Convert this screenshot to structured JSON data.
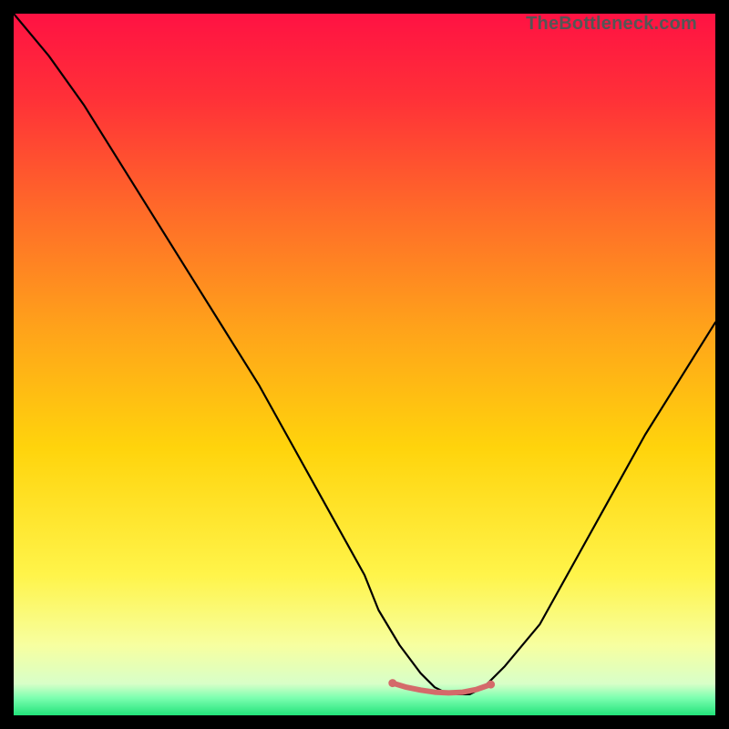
{
  "watermark": "TheBottleneck.com",
  "chart_data": {
    "type": "line",
    "title": "",
    "xlabel": "",
    "ylabel": "",
    "xlim": [
      0,
      100
    ],
    "ylim": [
      0,
      100
    ],
    "gradient_stops": [
      {
        "offset": 0.0,
        "color": "#ff1243"
      },
      {
        "offset": 0.12,
        "color": "#ff3038"
      },
      {
        "offset": 0.28,
        "color": "#ff6a29"
      },
      {
        "offset": 0.45,
        "color": "#ffa31a"
      },
      {
        "offset": 0.62,
        "color": "#ffd40c"
      },
      {
        "offset": 0.8,
        "color": "#fff44a"
      },
      {
        "offset": 0.9,
        "color": "#f7ffa0"
      },
      {
        "offset": 0.955,
        "color": "#d8ffc8"
      },
      {
        "offset": 0.975,
        "color": "#7dffb0"
      },
      {
        "offset": 1.0,
        "color": "#22e37a"
      }
    ],
    "series": [
      {
        "name": "bottleneck-curve",
        "color": "#000000",
        "width": 2.2,
        "x": [
          0,
          5,
          10,
          15,
          20,
          25,
          30,
          35,
          40,
          45,
          50,
          52,
          55,
          58,
          60,
          62,
          65,
          67,
          70,
          75,
          80,
          85,
          90,
          95,
          100
        ],
        "y_percent": [
          100,
          94,
          87,
          79,
          71,
          63,
          55,
          47,
          38,
          29,
          20,
          15,
          10,
          6,
          4,
          3,
          3,
          4,
          7,
          13,
          22,
          31,
          40,
          48,
          56
        ]
      },
      {
        "name": "optimal-range-marker",
        "color": "#d46a6a",
        "width": 6,
        "x": [
          54,
          56,
          58,
          60,
          62,
          64,
          66,
          68
        ],
        "y_percent": [
          4.6,
          4.0,
          3.6,
          3.3,
          3.2,
          3.3,
          3.7,
          4.4
        ]
      }
    ]
  }
}
